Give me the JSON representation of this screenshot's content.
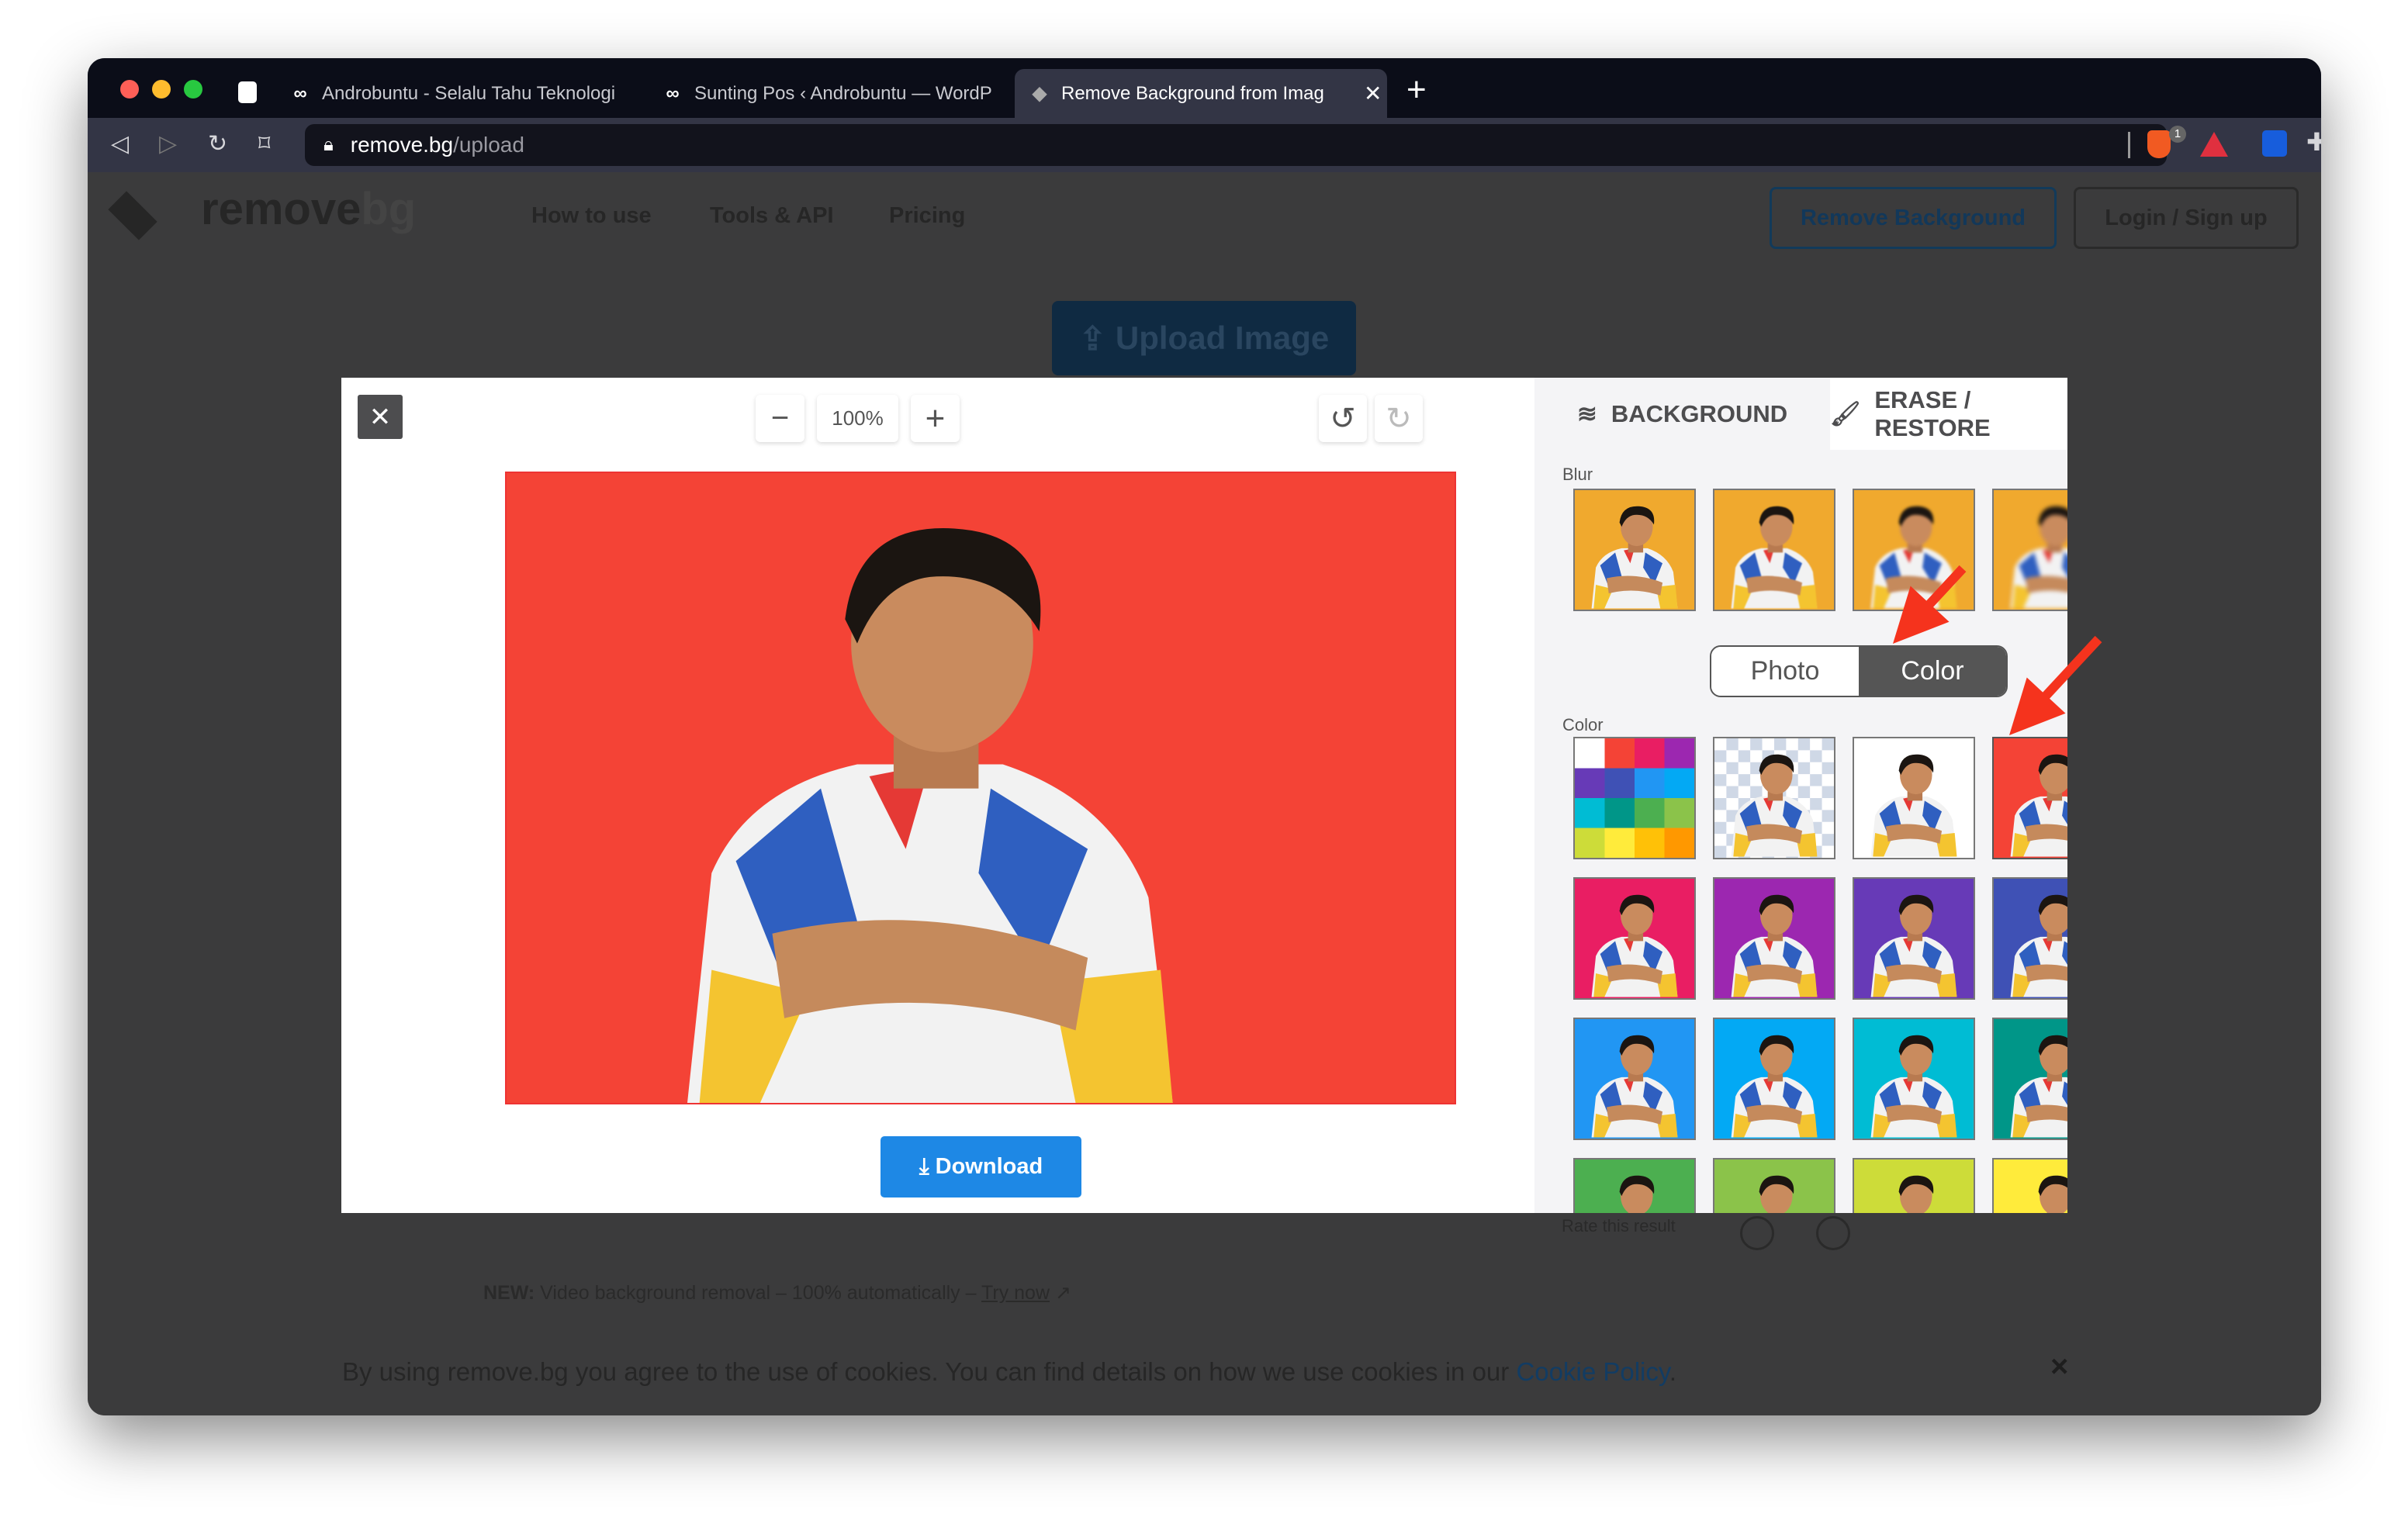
{
  "browser": {
    "tabs": [
      {
        "label": "Androbuntu - Selalu Tahu Teknologi",
        "icon": "infinity-icon"
      },
      {
        "label": "Sunting Pos ‹ Androbuntu — WordP",
        "icon": "infinity-icon"
      },
      {
        "label": "Remove Background from Imag",
        "icon": "removebg-icon",
        "active": true
      }
    ],
    "url_host": "remove.bg",
    "url_path": "/upload",
    "shield_badge": "1"
  },
  "site": {
    "logo_main": "remove",
    "logo_suffix": "bg",
    "nav": [
      "How to use",
      "Tools & API",
      "Pricing"
    ],
    "remove_bg_button": "Remove Background",
    "login_button": "Login / Sign up",
    "upload_button": "Upload Image",
    "rate_text": "Rate this result",
    "news_label": "NEW:",
    "news_text": " Video background removal – 100% automatically – ",
    "news_link": "Try now",
    "cookie_text": "By using remove.bg you agree to the use of cookies. You can find details on how we use cookies in our ",
    "cookie_link": "Cookie Policy",
    "cookie_end": ".",
    "cookie_close": "×"
  },
  "editor": {
    "close": "✕",
    "zoom_out": "−",
    "zoom_level": "100%",
    "zoom_in": "+",
    "download": "Download",
    "background_color": "#f44336",
    "tabs": {
      "background": "BACKGROUND",
      "erase": "ERASE / RESTORE"
    },
    "blur_label": "Blur",
    "toggle": {
      "photo": "Photo",
      "color": "Color",
      "selected": "Color"
    },
    "color_label": "Color",
    "blur_amounts": [
      0,
      1,
      2,
      3
    ],
    "colors": [
      "palette",
      "transparent",
      "#ffffff",
      "#f44336",
      "#e91e63",
      "#9c27b0",
      "#673ab7",
      "#3f51b5",
      "#2196f3",
      "#03a9f4",
      "#00bcd4",
      "#009688",
      "#4caf50",
      "#8bc34a",
      "#cddc39",
      "#ffeb3b"
    ],
    "selected_color": "#f44336",
    "blur_bg": "#f0a92e"
  },
  "annotation_color": "#f5331d"
}
